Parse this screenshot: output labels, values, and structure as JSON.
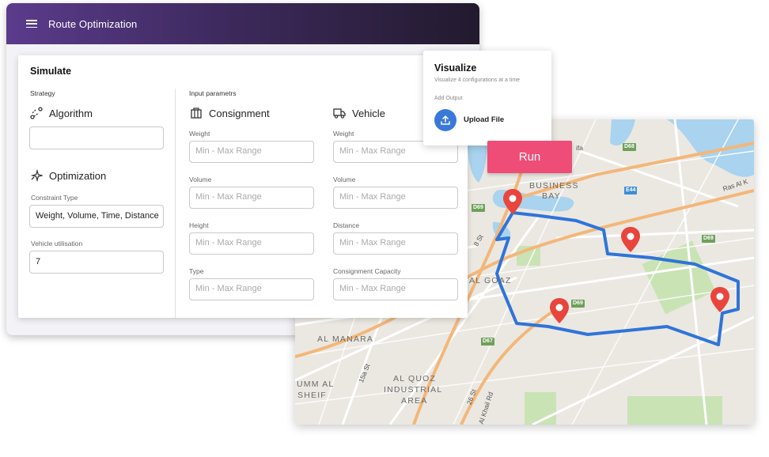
{
  "app": {
    "title": "Route Optimization"
  },
  "simulate": {
    "title": "Simulate",
    "strategy_label": "Strategy",
    "algorithm": {
      "heading": "Algorithm",
      "value": ""
    },
    "optimization": {
      "heading": "Optimization",
      "constraint_type_label": "Constraint Type",
      "constraint_type_value": "Weight, Volume, Time, Distance",
      "vehicle_utilisation_label": "Vehicle utilisation",
      "vehicle_utilisation_value": "7"
    },
    "input_params_label": "Input parametrs",
    "consignment": {
      "heading": "Consignment",
      "fields": [
        {
          "label": "Weight",
          "placeholder": "Min - Max Range"
        },
        {
          "label": "Volume",
          "placeholder": "Min - Max Range"
        },
        {
          "label": "Height",
          "placeholder": "Min - Max Range"
        },
        {
          "label": "Type",
          "placeholder": "Min - Max Range"
        }
      ]
    },
    "vehicle": {
      "heading": "Vehicle",
      "fields": [
        {
          "label": "Weight",
          "placeholder": "Min - Max Range"
        },
        {
          "label": "Volume",
          "placeholder": "Min - Max Range"
        },
        {
          "label": "Distance",
          "placeholder": "Min - Max Range"
        },
        {
          "label": "Consignment Capacity",
          "placeholder": "Min - Max Range"
        }
      ]
    }
  },
  "visualize": {
    "title": "Visualize",
    "subtitle": "Visualize 4 configurations at a time",
    "add_output_label": "Add Output",
    "upload_label": "Upload File",
    "upload_icon": "upload-icon"
  },
  "run_button": {
    "label": "Run"
  },
  "map": {
    "area_labels": [
      "BUSINESS",
      "BAY",
      "AL GOAZ",
      "AL MANARA",
      "UMM AL",
      "SHEIF",
      "AL QUOZ",
      "INDUSTRIAL",
      "AREA"
    ],
    "street_labels": [
      "ifa",
      "8 St",
      "15a St",
      "26 St",
      "Al Khail Rd",
      "Ras Al K"
    ],
    "road_tags": [
      "D68",
      "E44",
      "D69",
      "D69",
      "D69",
      "D67"
    ],
    "colors": {
      "route": "#2f74d8",
      "pin": "#e8453c",
      "water": "#a9d3ee",
      "park": "#c9e3b5",
      "road": "#f3b779"
    }
  }
}
